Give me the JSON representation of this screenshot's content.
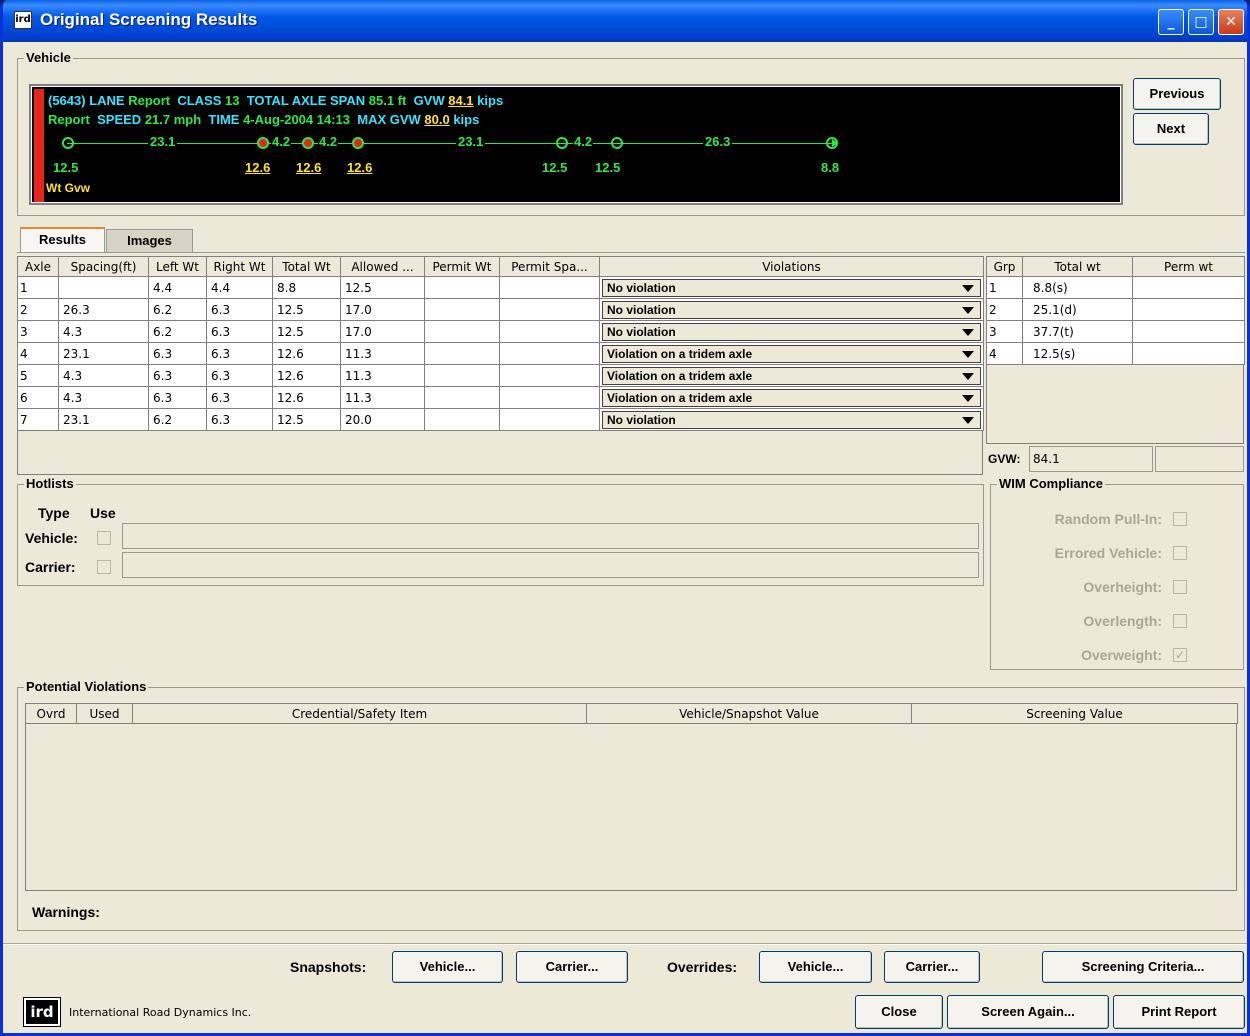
{
  "window": {
    "title": "Original Screening Results"
  },
  "vehicle": {
    "group_label": "Vehicle",
    "line1": {
      "a": "(5643)",
      "b": " LANE ",
      "c": "Report",
      "d": "  CLASS ",
      "e": "13",
      "f": "  TOTAL AXLE SPAN ",
      "g": "85.1 ft",
      "h": "  GVW ",
      "i": "84.1",
      "j": " kips"
    },
    "line2": {
      "a": "Report",
      "b": "  SPEED ",
      "c": "21.7 mph",
      "d": "  TIME ",
      "e": "4-Aug-2004 14:13",
      "f": "  MAX GVW ",
      "g": "80.0",
      "h": " kips"
    },
    "spacings": [
      "23.1",
      "4.2",
      "4.2",
      "23.1",
      "4.2",
      "26.3"
    ],
    "axle_weights": [
      "12.5",
      "12.6",
      "12.6",
      "12.6",
      "12.5",
      "12.5",
      "8.8"
    ],
    "legend": "Wt Gvw",
    "previous_button": "Previous",
    "next_button": "Next"
  },
  "tabs": [
    {
      "label": "Results",
      "active": true
    },
    {
      "label": "Images",
      "active": false
    }
  ],
  "axle_table": {
    "columns": [
      "Axle",
      "Spacing(ft)",
      "Left Wt",
      "Right Wt",
      "Total Wt",
      "Allowed ...",
      "Permit Wt",
      "Permit Spa...",
      "Violations"
    ],
    "rows": [
      [
        "1",
        "",
        "4.4",
        "4.4",
        "8.8",
        "12.5",
        "",
        "",
        "No violation"
      ],
      [
        "2",
        "26.3",
        "6.2",
        "6.3",
        "12.5",
        "17.0",
        "",
        "",
        "No violation"
      ],
      [
        "3",
        "4.3",
        "6.2",
        "6.3",
        "12.5",
        "17.0",
        "",
        "",
        "No violation"
      ],
      [
        "4",
        "23.1",
        "6.3",
        "6.3",
        "12.6",
        "11.3",
        "",
        "",
        "Violation on a tridem axle"
      ],
      [
        "5",
        "4.3",
        "6.3",
        "6.3",
        "12.6",
        "11.3",
        "",
        "",
        "Violation on a tridem axle"
      ],
      [
        "6",
        "4.3",
        "6.3",
        "6.3",
        "12.6",
        "11.3",
        "",
        "",
        "Violation on a tridem axle"
      ],
      [
        "7",
        "23.1",
        "6.2",
        "6.3",
        "12.5",
        "20.0",
        "",
        "",
        "No violation"
      ]
    ]
  },
  "group_table": {
    "columns": [
      "Grp",
      "Total wt",
      "Perm wt"
    ],
    "rows": [
      [
        "1",
        "8.8(s)",
        ""
      ],
      [
        "2",
        "25.1(d)",
        ""
      ],
      [
        "3",
        "37.7(t)",
        ""
      ],
      [
        "4",
        "12.5(s)",
        ""
      ]
    ],
    "gvw_label": "GVW:",
    "gvw_value": "84.1"
  },
  "hotlists": {
    "group_label": "Hotlists",
    "type_header": "Type",
    "use_header": "Use",
    "vehicle_label": "Vehicle:",
    "carrier_label": "Carrier:",
    "vehicle_value": "",
    "carrier_value": ""
  },
  "wim": {
    "group_label": "WIM Compliance",
    "items": [
      {
        "label": "Random Pull-In:",
        "checked": false
      },
      {
        "label": "Errored Vehicle:",
        "checked": false
      },
      {
        "label": "Overheight:",
        "checked": false
      },
      {
        "label": "Overlength:",
        "checked": false
      },
      {
        "label": "Overweight:",
        "checked": true
      }
    ]
  },
  "potential_violations": {
    "group_label": "Potential Violations",
    "columns": [
      "Ovrd",
      "Used",
      "Credential/Safety Item",
      "Vehicle/Snapshot Value",
      "Screening Value"
    ],
    "warnings_label": "Warnings:"
  },
  "footer": {
    "snapshots_label": "Snapshots:",
    "snap_vehicle": "Vehicle...",
    "snap_carrier": "Carrier...",
    "overrides_label": "Overrides:",
    "ovr_vehicle": "Vehicle...",
    "ovr_carrier": "Carrier...",
    "screening_criteria": "Screening Criteria...",
    "company": "International Road Dynamics Inc.",
    "close": "Close",
    "screen_again": "Screen Again...",
    "print_report": "Print Report"
  },
  "colors": {
    "title_bar": "#0058e6",
    "display_bg": "#000000",
    "cyan_text": "#39e3ff",
    "green_text": "#2ee84a",
    "yellow_text": "#ffe328",
    "red_marker": "#e8251b"
  }
}
